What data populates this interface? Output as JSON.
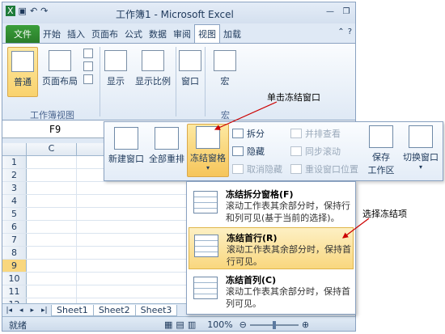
{
  "window": {
    "title": "工作簿1 - Microsoft Excel"
  },
  "tabs": [
    {
      "label": "文件"
    },
    {
      "label": "开始"
    },
    {
      "label": "插入"
    },
    {
      "label": "页面布"
    },
    {
      "label": "公式"
    },
    {
      "label": "数据"
    },
    {
      "label": "审阅"
    },
    {
      "label": "视图"
    },
    {
      "label": "加载"
    }
  ],
  "ribbon": {
    "normal": "普通",
    "page_layout": "页面布局",
    "show": "显示",
    "zoom": "显示比例",
    "window": "窗口",
    "macro": "宏",
    "group_workbook_views": "工作簿视图",
    "group_macro": "宏"
  },
  "formula_bar": {
    "name_box": "F9"
  },
  "grid": {
    "column": "C",
    "rows": [
      "1",
      "2",
      "3",
      "4",
      "5",
      "6",
      "7",
      "8",
      "9",
      "10",
      "11",
      "12"
    ],
    "selected_row": "9"
  },
  "sheets": [
    "Sheet1",
    "Sheet2",
    "Sheet3"
  ],
  "status": {
    "ready": "就绪",
    "zoom": "100%"
  },
  "window_panel": {
    "new_window": "新建窗口",
    "arrange_all": "全部重排",
    "freeze_panes": "冻结窗格",
    "split": "拆分",
    "hide": "隐藏",
    "unhide": "取消隐藏",
    "side_by_side": "并排查看",
    "sync_scroll": "同步滚动",
    "reset_position": "重设窗口位置",
    "save_workspace": "保存\n工作区",
    "switch_windows": "切换窗口"
  },
  "dropdown": [
    {
      "title": "冻结拆分窗格(F)",
      "desc": "滚动工作表其余部分时，保持行和列可见(基于当前的选择)。"
    },
    {
      "title": "冻结首行(R)",
      "desc": "滚动工作表其余部分时，保持首行可见。"
    },
    {
      "title": "冻结首列(C)",
      "desc": "滚动工作表其余部分时，保持首列可见。"
    }
  ],
  "annotations": {
    "click_freeze": "单击冻结窗口",
    "select_freeze": "选择冻结项"
  },
  "colors": {
    "accent": "#cc0000",
    "selected": "#f9d77e"
  }
}
